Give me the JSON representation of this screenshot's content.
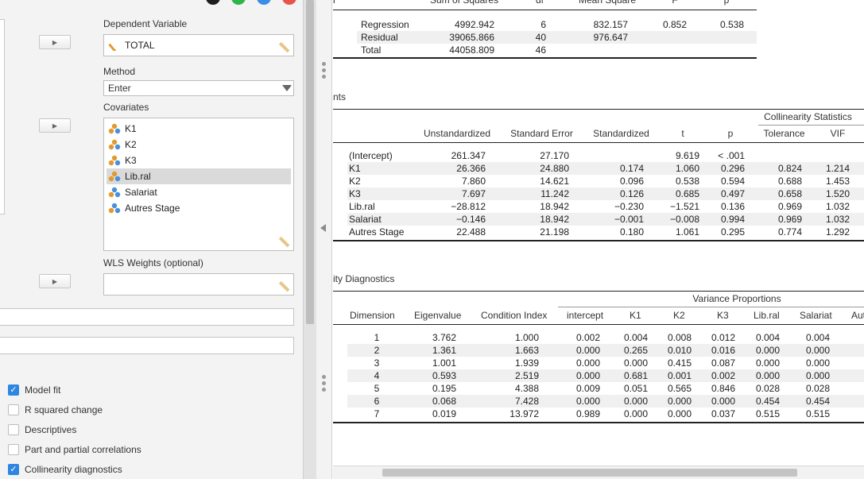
{
  "colors": {
    "accent": "#2f86e0",
    "window_dots": [
      "#1e1e1e",
      "#2fb54a",
      "#3a8ee6",
      "#e8544c"
    ]
  },
  "options": {
    "dependent_variable": {
      "label": "Dependent Variable",
      "value": "TOTAL"
    },
    "method": {
      "label": "Method",
      "value": "Enter"
    },
    "covariates": {
      "label": "Covariates",
      "items": [
        "K1",
        "K2",
        "K3",
        "Lib.ral",
        "Salariat",
        "Autres Stage"
      ],
      "selected": "Lib.ral"
    },
    "wls": {
      "label": "WLS Weights (optional)"
    },
    "checks": [
      {
        "label": "Model fit",
        "checked": true
      },
      {
        "label": "R squared change",
        "checked": false
      },
      {
        "label": "Descriptives",
        "checked": false
      },
      {
        "label": "Part and partial correlations",
        "checked": false
      },
      {
        "label": "Collinearity diagnostics",
        "checked": true
      }
    ],
    "arrow_glyph": "▶"
  },
  "anova": {
    "headers": [
      "Sum of Squares",
      "df",
      "Mean Square",
      "F",
      "p"
    ],
    "prefix": "l",
    "rows": [
      [
        "Regression",
        "4992.942",
        "6",
        "832.157",
        "0.852",
        "0.538"
      ],
      [
        "Residual",
        "39065.866",
        "40",
        "976.647",
        "",
        ""
      ],
      [
        "Total",
        "44058.809",
        "46",
        "",
        "",
        ""
      ]
    ]
  },
  "coefficients": {
    "title": "nts",
    "group_header": "Collinearity Statistics",
    "headers": [
      "Unstandardized",
      "Standard Error",
      "Standardized",
      "t",
      "p",
      "Tolerance",
      "VIF"
    ],
    "rows": [
      [
        "(Intercept)",
        "261.347",
        "27.170",
        "",
        "9.619",
        "< .001",
        "",
        ""
      ],
      [
        "K1",
        "26.366",
        "24.880",
        "0.174",
        "1.060",
        "0.296",
        "0.824",
        "1.214"
      ],
      [
        "K2",
        "7.860",
        "14.621",
        "0.096",
        "0.538",
        "0.594",
        "0.688",
        "1.453"
      ],
      [
        "K3",
        "7.697",
        "11.242",
        "0.126",
        "0.685",
        "0.497",
        "0.658",
        "1.520"
      ],
      [
        "Lib.ral",
        "−28.812",
        "18.942",
        "−0.230",
        "−1.521",
        "0.136",
        "0.969",
        "1.032"
      ],
      [
        "Salariat",
        "−0.146",
        "18.942",
        "−0.001",
        "−0.008",
        "0.994",
        "0.969",
        "1.032"
      ],
      [
        "Autres Stage",
        "22.488",
        "21.198",
        "0.180",
        "1.061",
        "0.295",
        "0.774",
        "1.292"
      ]
    ]
  },
  "diagnostics": {
    "title": "ity Diagnostics",
    "group_header": "Variance Proportions",
    "headers": [
      "Dimension",
      "Eigenvalue",
      "Condition Index",
      "intercept",
      "K1",
      "K2",
      "K3",
      "Lib.ral",
      "Salariat",
      "Aut"
    ],
    "rows": [
      [
        "1",
        "3.762",
        "1.000",
        "0.002",
        "0.004",
        "0.008",
        "0.012",
        "0.004",
        "0.004"
      ],
      [
        "2",
        "1.361",
        "1.663",
        "0.000",
        "0.265",
        "0.010",
        "0.016",
        "0.000",
        "0.000"
      ],
      [
        "3",
        "1.001",
        "1.939",
        "0.000",
        "0.000",
        "0.415",
        "0.087",
        "0.000",
        "0.000"
      ],
      [
        "4",
        "0.593",
        "2.519",
        "0.000",
        "0.681",
        "0.001",
        "0.002",
        "0.000",
        "0.000"
      ],
      [
        "5",
        "0.195",
        "4.388",
        "0.009",
        "0.051",
        "0.565",
        "0.846",
        "0.028",
        "0.028"
      ],
      [
        "6",
        "0.068",
        "7.428",
        "0.000",
        "0.000",
        "0.000",
        "0.000",
        "0.454",
        "0.454"
      ],
      [
        "7",
        "0.019",
        "13.972",
        "0.989",
        "0.000",
        "0.000",
        "0.037",
        "0.515",
        "0.515"
      ]
    ]
  }
}
